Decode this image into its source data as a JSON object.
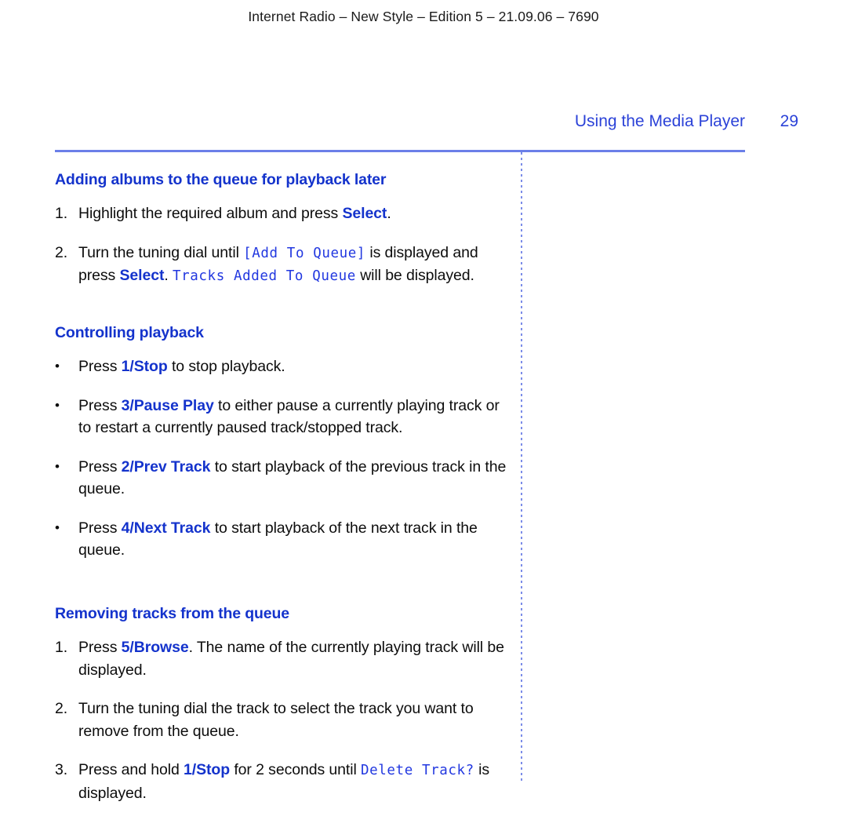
{
  "document": {
    "running_head": "Internet Radio – New Style – Edition 5 – 21.09.06 – 7690",
    "chapter_title": "Using the Media Player",
    "page_number": "29"
  },
  "colors": {
    "heading_blue": "#1433cc",
    "header_blue": "#2b42d8",
    "rule_blue": "#6b7fe8",
    "lcd_blue": "#2238e0",
    "body_black": "#0d0d0d"
  },
  "sections": [
    {
      "id": "adding-albums",
      "heading": "Adding albums to the queue for playback later",
      "list_type": "ordered",
      "items": [
        {
          "marker": "1.",
          "parts": [
            {
              "type": "text",
              "text": "Highlight the required album and press "
            },
            {
              "type": "key",
              "text": "Select"
            },
            {
              "type": "text",
              "text": "."
            }
          ]
        },
        {
          "marker": "2.",
          "parts": [
            {
              "type": "text",
              "text": "Turn the tuning dial until "
            },
            {
              "type": "lcd",
              "text": "[Add To Queue]"
            },
            {
              "type": "text",
              "text": " is displayed and press "
            },
            {
              "type": "key",
              "text": "Select"
            },
            {
              "type": "text",
              "text": ". "
            },
            {
              "type": "lcd",
              "text": "Tracks Added To Queue"
            },
            {
              "type": "text",
              "text": " will be displayed."
            }
          ]
        }
      ]
    },
    {
      "id": "controlling-playback",
      "heading": "Controlling playback",
      "list_type": "bullet",
      "items": [
        {
          "marker": "•",
          "parts": [
            {
              "type": "text",
              "text": "Press "
            },
            {
              "type": "key",
              "text": "1/Stop"
            },
            {
              "type": "text",
              "text": " to stop playback."
            }
          ]
        },
        {
          "marker": "•",
          "parts": [
            {
              "type": "text",
              "text": "Press "
            },
            {
              "type": "key",
              "text": "3/Pause Play"
            },
            {
              "type": "text",
              "text": " to either pause a currently playing track or to restart a currently paused track/stopped track."
            }
          ]
        },
        {
          "marker": "•",
          "parts": [
            {
              "type": "text",
              "text": "Press "
            },
            {
              "type": "key",
              "text": "2/Prev Track"
            },
            {
              "type": "text",
              "text": " to start playback of the previous track in the queue."
            }
          ]
        },
        {
          "marker": "•",
          "parts": [
            {
              "type": "text",
              "text": "Press "
            },
            {
              "type": "key",
              "text": "4/Next Track"
            },
            {
              "type": "text",
              "text": " to start playback of the next track in the queue."
            }
          ]
        }
      ]
    },
    {
      "id": "removing-tracks",
      "heading": "Removing tracks from the queue",
      "list_type": "ordered",
      "items": [
        {
          "marker": "1.",
          "parts": [
            {
              "type": "text",
              "text": "Press "
            },
            {
              "type": "key",
              "text": "5/Browse"
            },
            {
              "type": "text",
              "text": ". The name of the currently playing track will be displayed."
            }
          ]
        },
        {
          "marker": "2.",
          "parts": [
            {
              "type": "text",
              "text": "Turn the tuning dial the track to select the track you want to remove from the queue."
            }
          ]
        },
        {
          "marker": "3.",
          "parts": [
            {
              "type": "text",
              "text": "Press and hold "
            },
            {
              "type": "key",
              "text": "1/Stop"
            },
            {
              "type": "text",
              "text": " for 2 seconds until "
            },
            {
              "type": "lcd",
              "text": "Delete Track?"
            },
            {
              "type": "text",
              "text": " is displayed."
            }
          ]
        }
      ]
    }
  ]
}
